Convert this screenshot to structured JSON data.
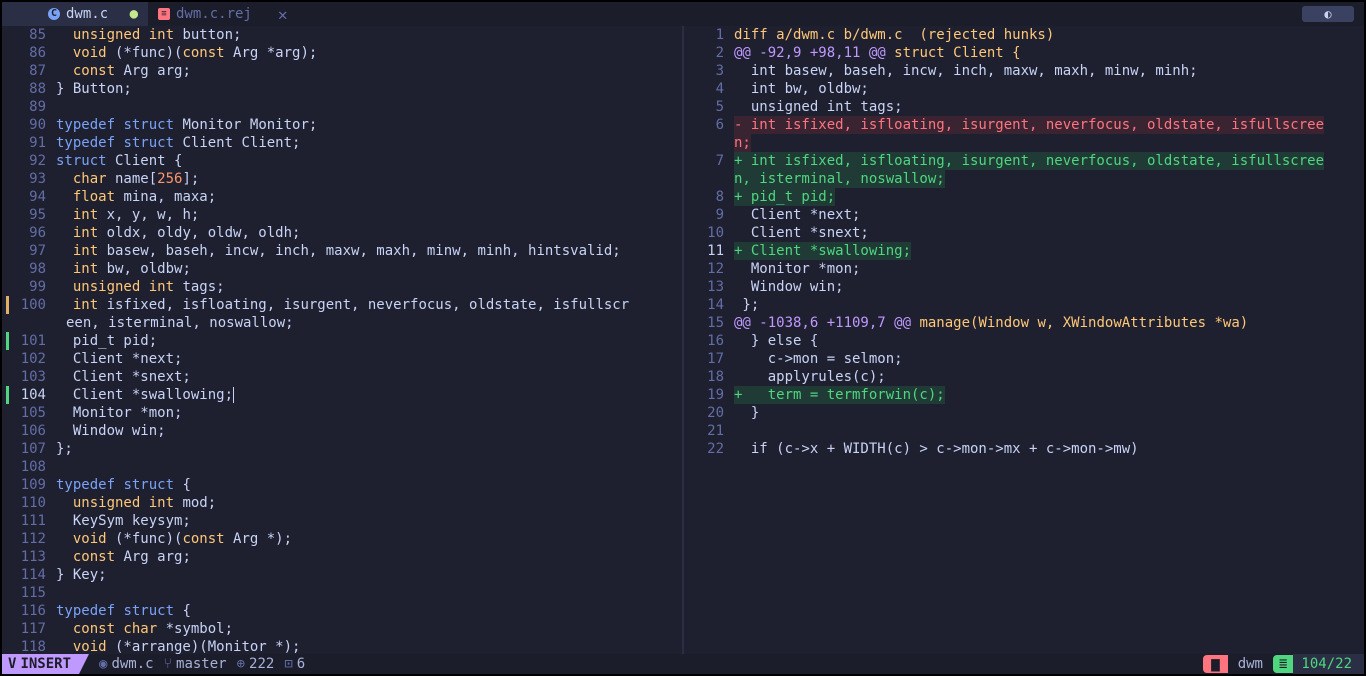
{
  "tabs": [
    {
      "label": "dwm.c",
      "active": true,
      "modified": true
    },
    {
      "label": "dwm.c.rej",
      "active": false
    }
  ],
  "left_pane": {
    "lines": [
      {
        "n": "85",
        "code": "  <ty>unsigned int</ty> button;"
      },
      {
        "n": "86",
        "code": "  <ty>void</ty> (*func)(<ty>const</ty> Arg *arg);"
      },
      {
        "n": "87",
        "code": "  <ty>const</ty> Arg arg;"
      },
      {
        "n": "88",
        "code": "} Button;"
      },
      {
        "n": "89",
        "code": ""
      },
      {
        "n": "90",
        "code": "<kw>typedef</kw> <kw>struct</kw> Monitor Monitor;"
      },
      {
        "n": "91",
        "code": "<kw>typedef</kw> <kw>struct</kw> Client Client;"
      },
      {
        "n": "92",
        "code": "<kw>struct</kw> Client {"
      },
      {
        "n": "93",
        "code": "  <ty>char</ty> name[<nm>256</nm>];"
      },
      {
        "n": "94",
        "code": "  <ty>float</ty> mina, maxa;"
      },
      {
        "n": "95",
        "code": "  <ty>int</ty> x, y, w, h;"
      },
      {
        "n": "96",
        "code": "  <ty>int</ty> oldx, oldy, oldw, oldh;"
      },
      {
        "n": "97",
        "code": "  <ty>int</ty> basew, baseh, incw, inch, maxw, maxh, minw, minh, hintsvalid;"
      },
      {
        "n": "98",
        "code": "  <ty>int</ty> bw, oldbw;"
      },
      {
        "n": "99",
        "code": "  <ty>unsigned int</ty> tags;"
      },
      {
        "n": "100",
        "code": "  <ty>int</ty> isfixed, isfloating, isurgent, neverfocus, oldstate, isfullscr",
        "sign": "chg"
      },
      {
        "n": "",
        "code": "een, isterminal, noswallow;",
        "cont": true
      },
      {
        "n": "101",
        "code": "  pid_t pid;",
        "sign": "add"
      },
      {
        "n": "102",
        "code": "  Client *next;"
      },
      {
        "n": "103",
        "code": "  Client *snext;"
      },
      {
        "n": "104",
        "code": "  Client *swallowing;",
        "sign": "add",
        "cursor": true,
        "cur": true
      },
      {
        "n": "105",
        "code": "  Monitor *mon;"
      },
      {
        "n": "106",
        "code": "  Window win;"
      },
      {
        "n": "107",
        "code": "};"
      },
      {
        "n": "108",
        "code": ""
      },
      {
        "n": "109",
        "code": "<kw>typedef</kw> <kw>struct</kw> {"
      },
      {
        "n": "110",
        "code": "  <ty>unsigned int</ty> mod;"
      },
      {
        "n": "111",
        "code": "  KeySym keysym;"
      },
      {
        "n": "112",
        "code": "  <ty>void</ty> (*func)(<ty>const</ty> Arg *);"
      },
      {
        "n": "113",
        "code": "  <ty>const</ty> Arg arg;"
      },
      {
        "n": "114",
        "code": "} Key;"
      },
      {
        "n": "115",
        "code": ""
      },
      {
        "n": "116",
        "code": "<kw>typedef</kw> <kw>struct</kw> {"
      },
      {
        "n": "117",
        "code": "  <ty>const char</ty> *symbol;"
      },
      {
        "n": "118",
        "code": "  <ty>void</ty> (*arrange)(Monitor *);"
      }
    ]
  },
  "right_pane": {
    "lines": [
      {
        "n": "1",
        "code": "<hdr>diff a/dwm.c b/dwm.c  (rejected hunks)</hdr>"
      },
      {
        "n": "2",
        "code": "<hunk>@@ -92,9 +98,11 @@</hunk> <hdr>struct Client {</hdr>"
      },
      {
        "n": "3",
        "code": "  int basew, baseh, incw, inch, maxw, maxh, minw, minh;"
      },
      {
        "n": "4",
        "code": "  int bw, oldbw;"
      },
      {
        "n": "5",
        "code": "  unsigned int tags;"
      },
      {
        "n": "6",
        "code": "- int isfixed, isfloating, isurgent, neverfocus, oldstate, isfullscree",
        "kind": "del"
      },
      {
        "n": "",
        "code": "n;",
        "kind": "del",
        "cont": true
      },
      {
        "n": "7",
        "code": "+ int isfixed, isfloating, isurgent, neverfocus, oldstate, isfullscree",
        "kind": "add"
      },
      {
        "n": "",
        "code": "n, isterminal, noswallow;",
        "kind": "add",
        "cont": true
      },
      {
        "n": "8",
        "code": "+ pid_t pid;",
        "kind": "add"
      },
      {
        "n": "9",
        "code": "  Client *next;"
      },
      {
        "n": "10",
        "code": "  Client *snext;"
      },
      {
        "n": "11",
        "code": "+ Client *swallowing;",
        "kind": "add",
        "cur": true
      },
      {
        "n": "12",
        "code": "  Monitor *mon;"
      },
      {
        "n": "13",
        "code": "  Window win;"
      },
      {
        "n": "14",
        "code": " };"
      },
      {
        "n": "15",
        "code": "<hunk>@@ -1038,6 +1109,7 @@</hunk> <hdr>manage(Window w, XWindowAttributes *wa)</hdr>"
      },
      {
        "n": "16",
        "code": "  } else {"
      },
      {
        "n": "17",
        "code": "    c->mon = selmon;"
      },
      {
        "n": "18",
        "code": "    applyrules(c);"
      },
      {
        "n": "19",
        "code": "+   term = termforwin(c);",
        "kind": "add"
      },
      {
        "n": "20",
        "code": "  }"
      },
      {
        "n": "21",
        "code": ""
      },
      {
        "n": "22",
        "code": "  if (c->x + WIDTH(c) > c->mon->mx + c->mon->mw)"
      }
    ]
  },
  "statusline": {
    "mode": "INSERT",
    "file": "dwm.c",
    "branch": "master",
    "added": "222",
    "changed": "6",
    "folder": "dwm",
    "position": "104/22"
  },
  "icons": {
    "c_file": "c-file-icon",
    "rej_file": "rej-file-icon",
    "close": "close-icon",
    "vim": "vim-icon",
    "git_branch": "git-branch-icon",
    "plus": "plus-circle-icon",
    "changed": "modified-square-icon",
    "folder": "folder-icon",
    "lines": "lines-icon"
  },
  "colors": {
    "mode_bg": "#c099ff",
    "added": "#4fd67f",
    "removed": "#ff757f",
    "hunk": "#c099ff",
    "header": "#ffc777"
  }
}
